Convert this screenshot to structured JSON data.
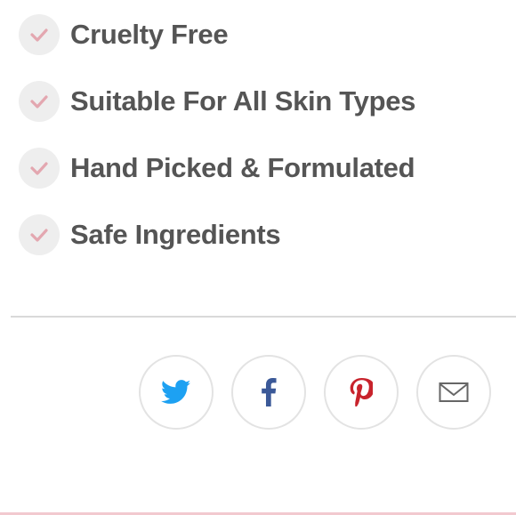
{
  "features": [
    {
      "label": "Cruelty Free"
    },
    {
      "label": "Suitable For All Skin Types"
    },
    {
      "label": "Hand Picked & Formulated"
    },
    {
      "label": "Safe Ingredients"
    }
  ],
  "icons": {
    "check": "check-icon",
    "twitter": "twitter-icon",
    "facebook": "facebook-icon",
    "pinterest": "pinterest-icon",
    "email": "email-icon"
  },
  "colors": {
    "check_mark": "#e3a7b0",
    "check_bg": "#eeeeee",
    "feature_text": "#555555",
    "divider": "#d9d9d9",
    "twitter": "#1da1f2",
    "facebook": "#3b5998",
    "pinterest": "#c8232c",
    "email": "#666666",
    "bottom_border": "#f2c9cf"
  }
}
